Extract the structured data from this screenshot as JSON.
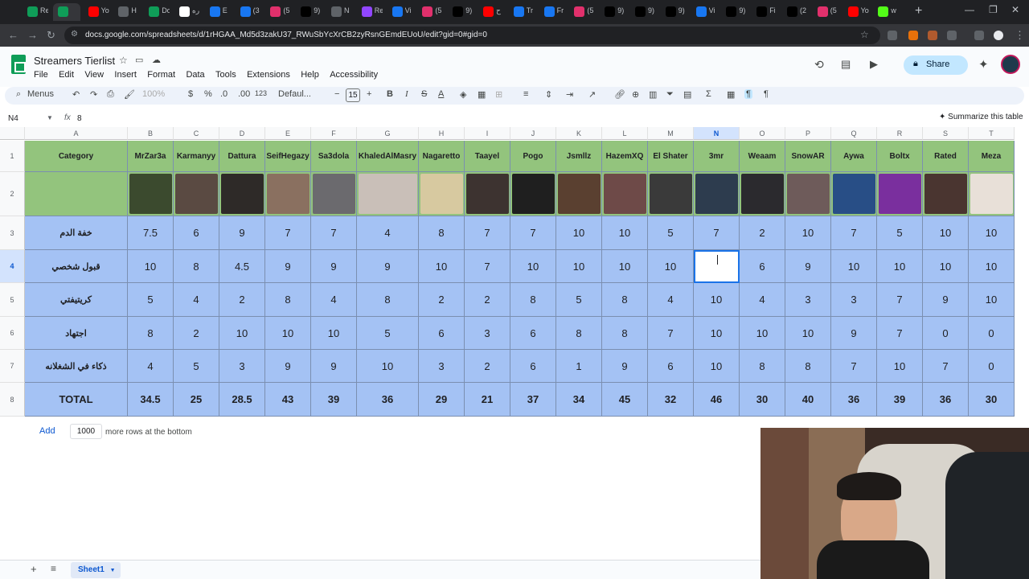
{
  "browser": {
    "url": "docs.google.com/spreadsheets/d/1rHGAA_Md5d3zakU37_RWuSbYcXrCB2zyRsnGEmdEUoU/edit?gid=0#gid=0",
    "tabs": [
      "Re",
      "",
      "Yo",
      "H",
      "Do",
      "ره",
      "E",
      "(3",
      "(5",
      "9)",
      "N",
      "Re",
      "Vi",
      "(5",
      "9)",
      "ح",
      "Tr",
      "Fr",
      "(5",
      "9)",
      "9)",
      "9)",
      "Vi",
      "9)",
      "Fi",
      "(2",
      "(5",
      "Yo",
      "w"
    ]
  },
  "doc": {
    "title": "Streamers Tierlist",
    "menus": [
      "File",
      "Edit",
      "View",
      "Insert",
      "Format",
      "Data",
      "Tools",
      "Extensions",
      "Help",
      "Accessibility"
    ],
    "share_label": "Share",
    "summarize_label": "Summarize this table"
  },
  "toolbar": {
    "menus_label": "Menus",
    "zoom": "100%",
    "currency": "$",
    "percent": "%",
    "decrease_decimal": ".0",
    "increase_decimal": ".00",
    "number_format": "123",
    "font": "Defaul...",
    "font_size": "15",
    "bold": "B",
    "italic": "I"
  },
  "formula_bar": {
    "name_box": "N4",
    "fx": "fx",
    "value": "8"
  },
  "grid": {
    "columns": [
      "A",
      "B",
      "C",
      "D",
      "E",
      "F",
      "G",
      "H",
      "I",
      "J",
      "K",
      "L",
      "M",
      "N",
      "O",
      "P",
      "Q",
      "R",
      "S",
      "T"
    ],
    "selected_column": "N",
    "row_numbers": [
      "1",
      "2",
      "3",
      "4",
      "5",
      "6",
      "7",
      "8"
    ],
    "selected_row": "4",
    "header_row": [
      "Category",
      "MrZar3a",
      "Karmanyy",
      "Dattura",
      "SeifHegazy",
      "Sa3dola",
      "KhaledAlMasry",
      "Nagaretto",
      "Taayel",
      "Pogo",
      "Jsmllz",
      "HazemXQ",
      "El Shater",
      "3mr",
      "Weaam",
      "SnowAR",
      "Aywa",
      "Boltx",
      "Rated",
      "Meza"
    ],
    "categories": [
      "خفة الدم",
      "قبول شخصي",
      "كريتيفتي",
      "اجتهاد",
      "ذكاء في الشغلانه",
      "TOTAL"
    ],
    "rows": [
      [
        "7.5",
        "6",
        "9",
        "7",
        "7",
        "4",
        "8",
        "7",
        "7",
        "10",
        "10",
        "5",
        "7",
        "2",
        "10",
        "7",
        "5",
        "10",
        "10"
      ],
      [
        "10",
        "8",
        "4.5",
        "9",
        "9",
        "9",
        "10",
        "7",
        "10",
        "10",
        "10",
        "10",
        "",
        "6",
        "9",
        "10",
        "10",
        "10",
        "10"
      ],
      [
        "5",
        "4",
        "2",
        "8",
        "4",
        "8",
        "2",
        "2",
        "8",
        "5",
        "8",
        "4",
        "10",
        "4",
        "3",
        "3",
        "7",
        "9",
        "10"
      ],
      [
        "8",
        "2",
        "10",
        "10",
        "10",
        "5",
        "6",
        "3",
        "6",
        "8",
        "8",
        "7",
        "10",
        "10",
        "10",
        "9",
        "7",
        "0",
        "0"
      ],
      [
        "4",
        "5",
        "3",
        "9",
        "9",
        "10",
        "3",
        "2",
        "6",
        "1",
        "9",
        "6",
        "10",
        "8",
        "8",
        "7",
        "10",
        "7",
        "0"
      ],
      [
        "34.5",
        "25",
        "28.5",
        "43",
        "39",
        "36",
        "29",
        "21",
        "37",
        "34",
        "45",
        "32",
        "46",
        "30",
        "40",
        "36",
        "39",
        "36",
        "30"
      ]
    ]
  },
  "bottom": {
    "add_label": "Add",
    "rows_count": "1000",
    "more_rows_text": "more rows at the bottom",
    "sheet_name": "Sheet1"
  },
  "colors": {
    "header_green": "#93c47d",
    "body_blue": "#a4c2f4",
    "selection": "#1a73e8"
  }
}
